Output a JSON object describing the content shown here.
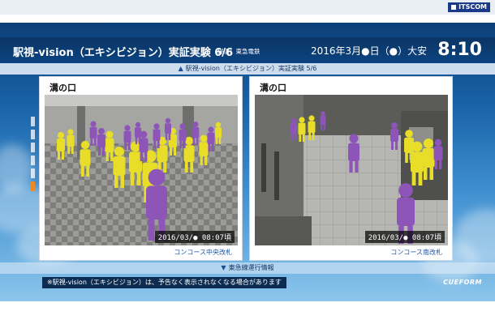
{
  "brand": {
    "name": "ITSCOM"
  },
  "header": {
    "title": "駅視-vision（エキシビジョン）実証実験 6/6",
    "provider": "提供：東急電鉄",
    "date": "2016年3月●日（●）大安",
    "time": "8:10"
  },
  "nav": {
    "prev": "駅視-vision（エキシビジョン）実証実験 5/6",
    "next": "東急線運行情報"
  },
  "side_indicator": {
    "count": 6,
    "active_index": 5
  },
  "cameras": [
    {
      "station": "溝の口",
      "timestamp": "2016/03/● 08:07頃",
      "location": "コンコース中央改札"
    },
    {
      "station": "溝の口",
      "timestamp": "2016/03/● 08:07頃",
      "location": "コンコース南改札"
    }
  ],
  "notice": "※駅視-vision（エキシビジョン）は、予告なく表示されなくなる場合があります",
  "footer_logo": "CUEFORM",
  "colors": {
    "person_yellow": "#e8de2a",
    "person_purple": "#8e55b8",
    "accent": "#ee8a1e"
  }
}
